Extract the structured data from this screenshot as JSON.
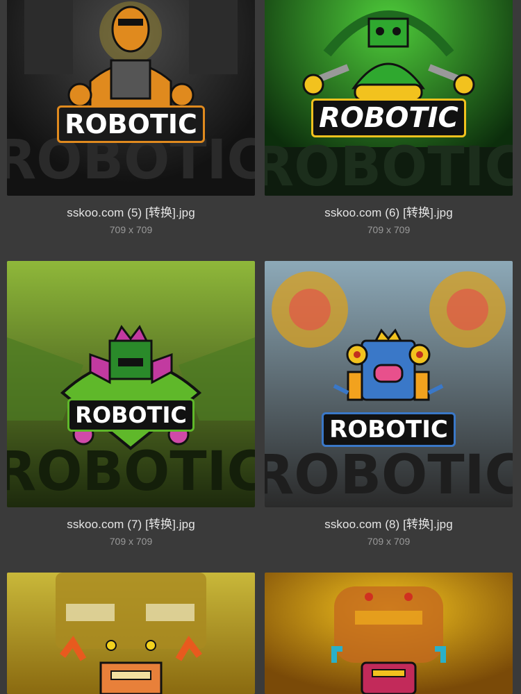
{
  "gallery": {
    "items": [
      {
        "filename": "sskoo.com (5) [转换].jpg",
        "dimensions": "709 x 709",
        "logo_text": "ROBOTIC",
        "theme": "#e08a1e"
      },
      {
        "filename": "sskoo.com (6) [转换].jpg",
        "dimensions": "709 x 709",
        "logo_text": "ROBOTIC",
        "theme": "#2fa82f"
      },
      {
        "filename": "sskoo.com (7) [转换].jpg",
        "dimensions": "709 x 709",
        "logo_text": "ROBOTIC",
        "theme": "#7bb52a"
      },
      {
        "filename": "sskoo.com (8) [转换].jpg",
        "dimensions": "709 x 709",
        "logo_text": "ROBOTIC",
        "theme": "#3a78c8"
      },
      {
        "filename": "",
        "dimensions": "",
        "logo_text": "",
        "theme": "#d8b21e"
      },
      {
        "filename": "",
        "dimensions": "",
        "logo_text": "",
        "theme": "#e0a012"
      }
    ]
  }
}
